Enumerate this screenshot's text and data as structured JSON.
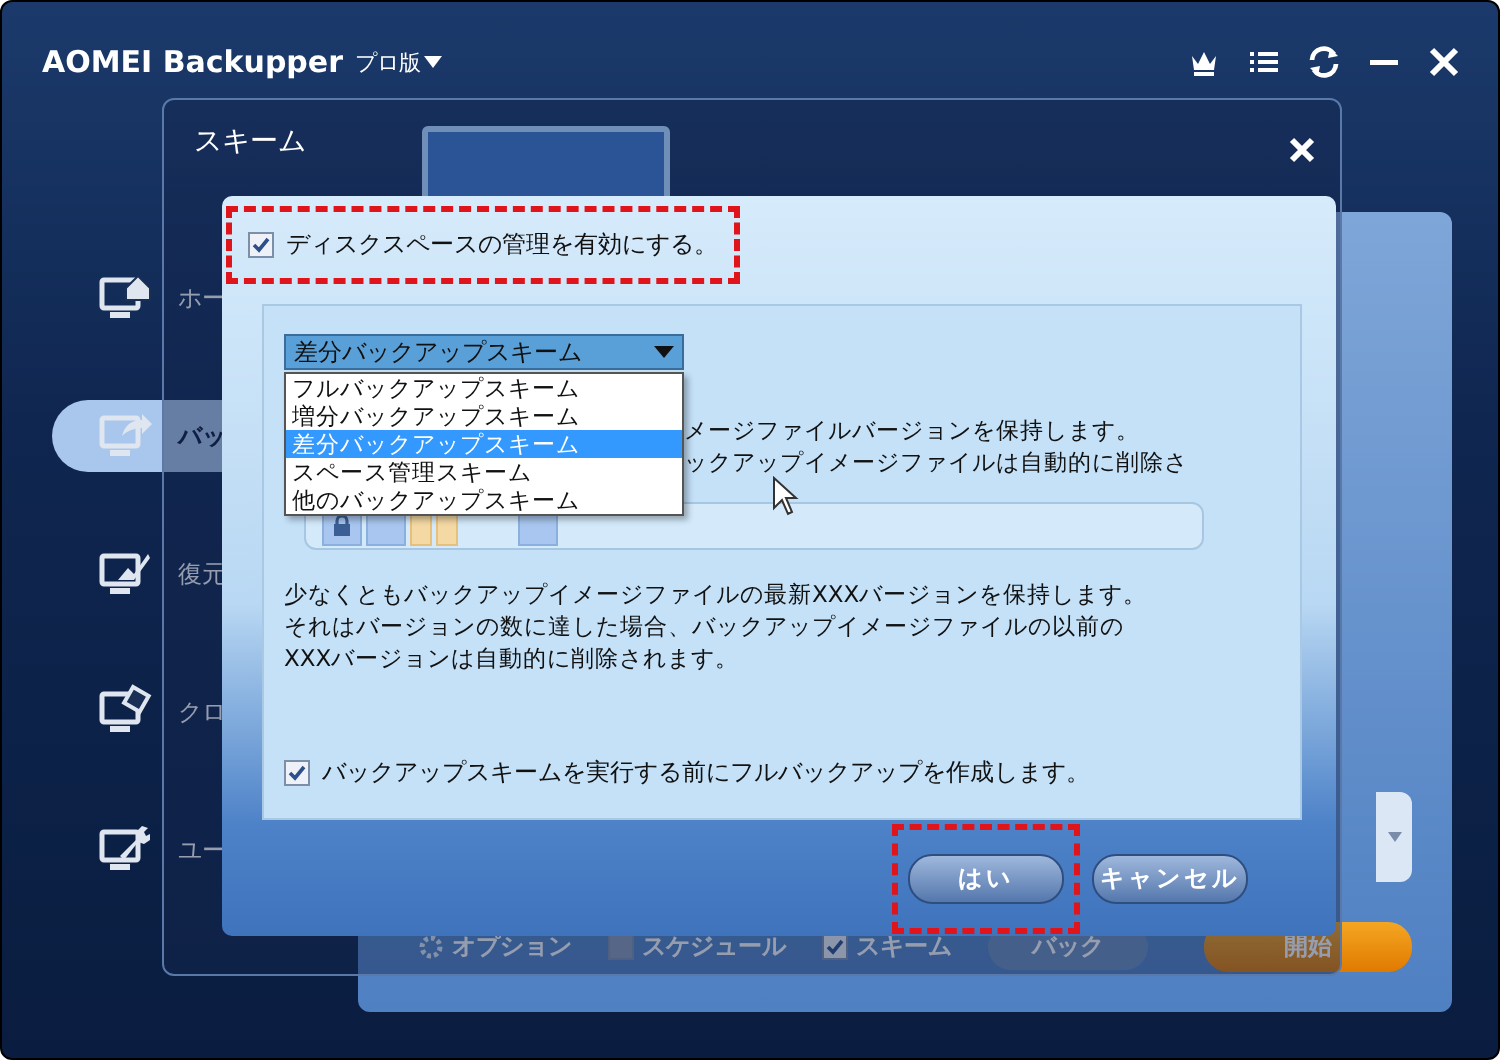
{
  "app": {
    "title": "AOMEI Backupper",
    "edition": "プロ版"
  },
  "sidebar": {
    "items": [
      {
        "label": "ホー",
        "kind": "home",
        "selected": false
      },
      {
        "label": "バッ",
        "kind": "backup",
        "selected": true
      },
      {
        "label": "復元",
        "kind": "restore",
        "selected": false
      },
      {
        "label": "クロ",
        "kind": "clone",
        "selected": false
      },
      {
        "label": "ユー",
        "kind": "tools",
        "selected": false
      }
    ]
  },
  "bottom_bar": {
    "options": "オプション",
    "schedule": {
      "label": "スケジュール",
      "checked": false
    },
    "scheme": {
      "label": "スキーム",
      "checked": true
    },
    "back": "バック",
    "start": "開始"
  },
  "dialog": {
    "title": "スキーム",
    "enable": {
      "label": "ディスクスペースの管理を有効にする。",
      "checked": true,
      "highlighted": true
    },
    "scheme_select": {
      "value": "差分バックアップスキーム",
      "options": [
        {
          "label": "フルバックアップスキーム",
          "selected": false
        },
        {
          "label": "増分バックアップスキーム",
          "selected": false
        },
        {
          "label": "差分バックアップスキーム",
          "selected": true
        },
        {
          "label": "スペース管理スキーム",
          "selected": false
        },
        {
          "label": "他のバックアップスキーム",
          "selected": false
        }
      ]
    },
    "description_fragments": [
      "メージファイルバージョンを保持します。",
      "ックアップイメージファイルは自動的に削除さ"
    ],
    "segments": [
      {
        "kind": "locked"
      },
      {
        "kind": "full"
      },
      {
        "kind": "differential"
      },
      {
        "kind": "differential"
      },
      {
        "kind": "empty"
      },
      {
        "kind": "full"
      }
    ],
    "note": "少なくともバックアップイメージファイルの最新XXXバージョンを保持します。それはバージョンの数に達した場合、バックアップイメージファイルの以前のXXXバージョンは自動的に削除されます。",
    "full_first": {
      "label": "バックアップスキームを実行する前にフルバックアップを作成します。",
      "checked": true
    },
    "buttons": [
      {
        "label": "はい",
        "highlighted": true
      },
      {
        "label": "キャンセル",
        "highlighted": false
      }
    ]
  }
}
